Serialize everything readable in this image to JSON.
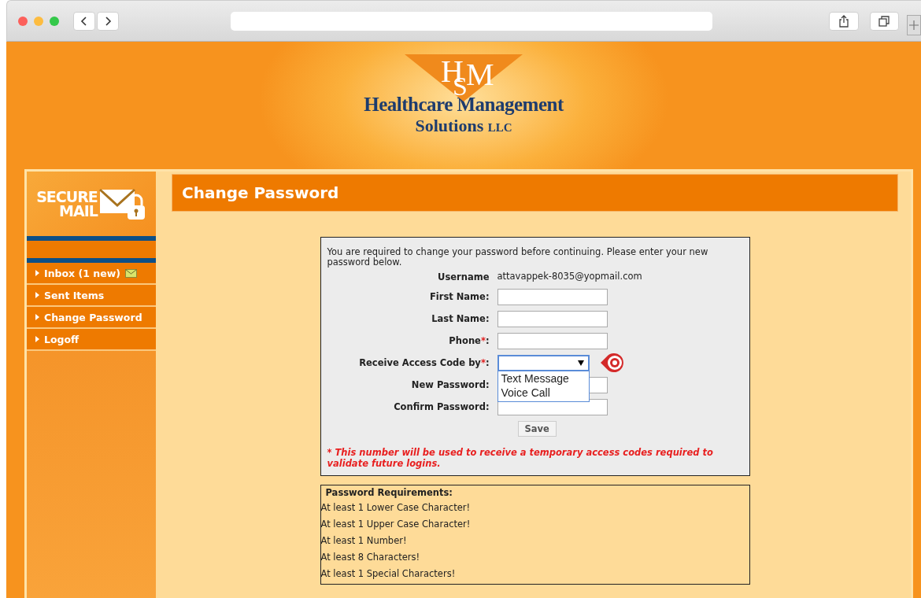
{
  "logo": {
    "monogram": [
      "H",
      "M",
      "S"
    ],
    "name_line1": "Healthcare Management",
    "name_line2": "Solutions",
    "name_suffix": "LLC"
  },
  "sidebar": {
    "banner": [
      "SECURE",
      "MAIL"
    ],
    "items": [
      {
        "label": "Inbox (1 new)",
        "has_mail_icon": true
      },
      {
        "label": "Sent Items",
        "has_mail_icon": false
      },
      {
        "label": "Change Password",
        "has_mail_icon": false
      },
      {
        "label": "Logoff",
        "has_mail_icon": false
      }
    ]
  },
  "page_title": "Change Password",
  "form": {
    "intro": "You are required to change your password before continuing. Please enter your new password below.",
    "username_label": "Username",
    "username_value": "attavappek-8035@yopmail.com",
    "fields": [
      {
        "kind": "text",
        "label": "First Name",
        "colon": ":"
      },
      {
        "kind": "text",
        "label": "Last Name",
        "colon": ":"
      },
      {
        "kind": "text",
        "label": "Phone",
        "required_mark": "*",
        "colon": ":"
      },
      {
        "kind": "select",
        "label": "Receive Access Code by",
        "required_mark": "*",
        "colon": ":",
        "expanded": true,
        "options": [
          "Text Message",
          "Voice Call"
        ]
      },
      {
        "kind": "password",
        "label": "New Password",
        "colon": ":"
      },
      {
        "kind": "password",
        "label": "Confirm Password",
        "colon": ":"
      }
    ],
    "save_button": "Save",
    "note_mark": "*",
    "note": "This number will be used to receive a temporary access codes required to validate future logins."
  },
  "requirements": {
    "title": "Password Requirements:",
    "items": [
      "At least 1 Lower Case Character!",
      "At least 1 Upper Case Character!",
      "At least 1 Number!",
      "At least 8 Characters!",
      "At least 1 Special Characters!"
    ]
  }
}
